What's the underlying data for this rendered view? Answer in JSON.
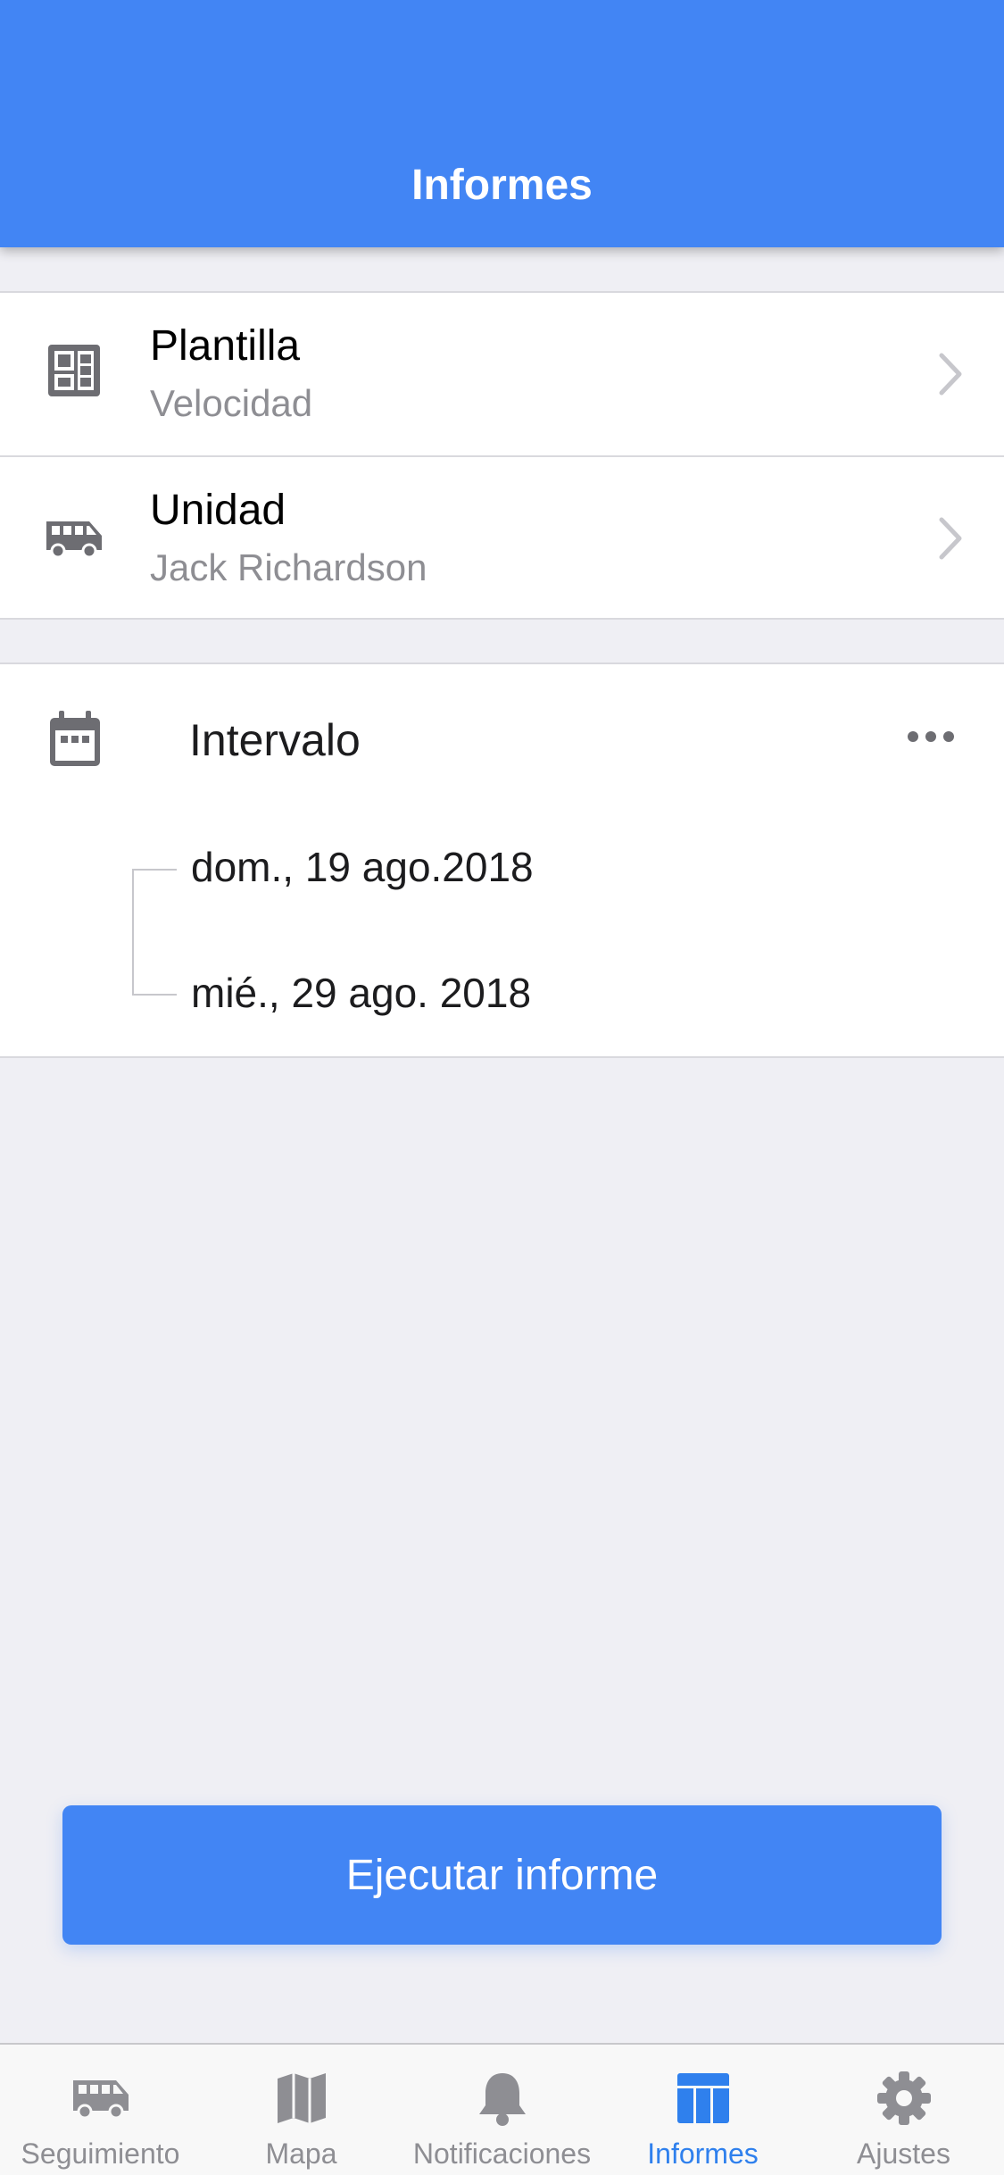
{
  "header": {
    "title": "Informes"
  },
  "settings": [
    {
      "icon": "template-icon",
      "title": "Plantilla",
      "value": "Velocidad"
    },
    {
      "icon": "van-icon",
      "title": "Unidad",
      "value": "Jack Richardson"
    }
  ],
  "interval": {
    "icon": "calendar-icon",
    "title": "Intervalo",
    "more_icon": "more-icon",
    "from": "dom., 19 ago.2018",
    "to": "mié., 29 ago. 2018"
  },
  "run_button": {
    "label": "Ejecutar informe"
  },
  "tabbar": {
    "active": "Informes",
    "items": [
      {
        "icon": "van-icon",
        "label": "Seguimiento"
      },
      {
        "icon": "map-icon",
        "label": "Mapa"
      },
      {
        "icon": "bell-icon",
        "label": "Notificaciones"
      },
      {
        "icon": "reports-table-icon",
        "label": "Informes"
      },
      {
        "icon": "gear-icon",
        "label": "Ajustes"
      }
    ]
  },
  "colors": {
    "accent": "#4285f4",
    "tab_active": "#2f80ed",
    "tab_inactive": "#8e8e93",
    "background": "#efeff4"
  }
}
